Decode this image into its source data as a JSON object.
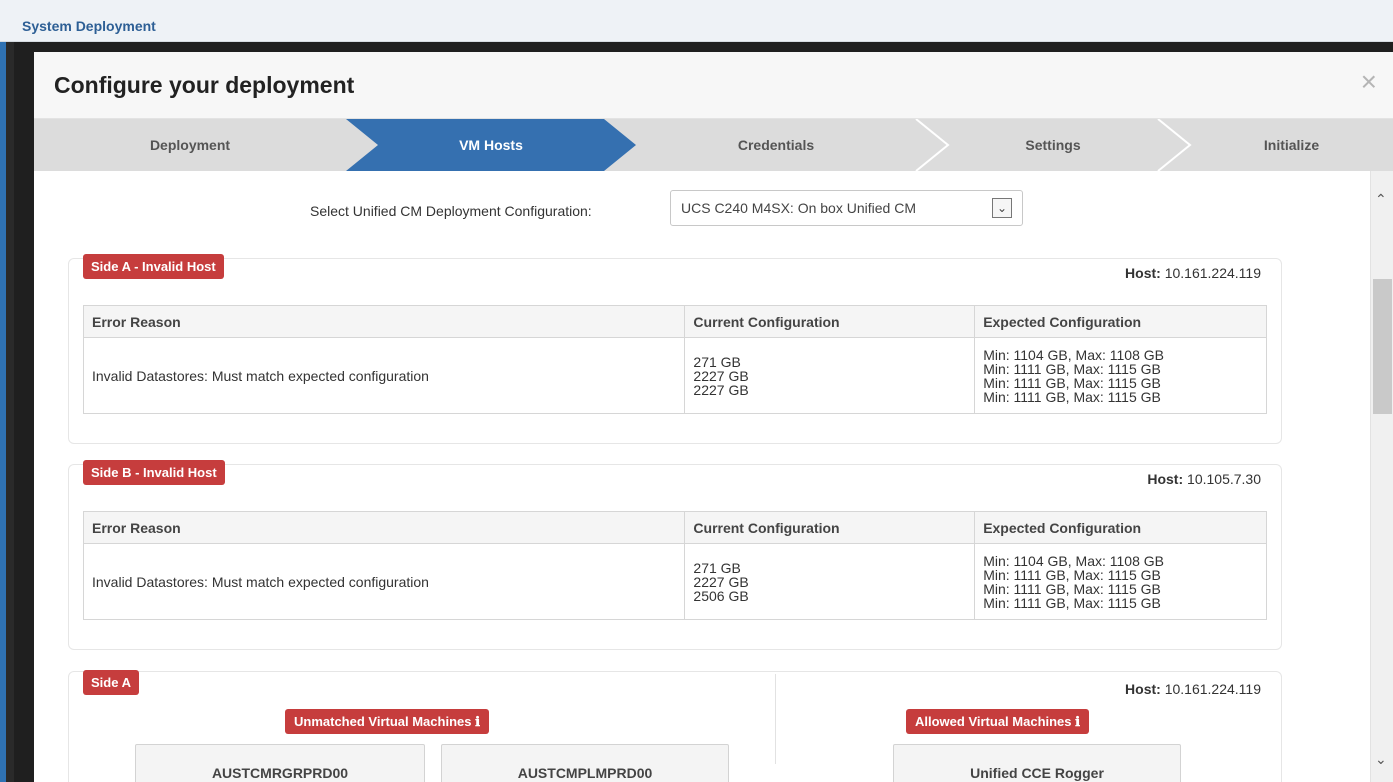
{
  "window": {
    "title": "System Deployment"
  },
  "modal": {
    "title": "Configure your deployment",
    "close_glyph": "×"
  },
  "wizard": {
    "steps": [
      {
        "label": "Deployment",
        "active": false
      },
      {
        "label": "VM Hosts",
        "active": true
      },
      {
        "label": "Credentials",
        "active": false
      },
      {
        "label": "Settings",
        "active": false
      },
      {
        "label": "Initialize",
        "active": false
      }
    ]
  },
  "config": {
    "label": "Select Unified CM Deployment Configuration:",
    "selected": "UCS C240 M4SX: On box Unified CM",
    "arrow": "⌄"
  },
  "table_headers": [
    "Error Reason",
    "Current Configuration",
    "Expected Configuration"
  ],
  "hosts": [
    {
      "badge": "Side A - Invalid Host",
      "host_label": "Host:",
      "host_ip": "10.161.224.119",
      "reason": "Invalid Datastores: Must match expected configuration",
      "current": [
        "271 GB",
        "2227 GB",
        "2227 GB"
      ],
      "expected": [
        "Min: 1104 GB, Max: 1108 GB",
        "Min: 1111 GB, Max: 1115 GB",
        "Min: 1111 GB, Max: 1115 GB",
        "Min: 1111 GB, Max: 1115 GB"
      ]
    },
    {
      "badge": "Side B - Invalid Host",
      "host_label": "Host:",
      "host_ip": "10.105.7.30",
      "reason": "Invalid Datastores: Must match expected configuration",
      "current": [
        "271 GB",
        "2227 GB",
        "2506 GB"
      ],
      "expected": [
        "Min: 1104 GB, Max: 1108 GB",
        "Min: 1111 GB, Max: 1115 GB",
        "Min: 1111 GB, Max: 1115 GB",
        "Min: 1111 GB, Max: 1115 GB"
      ]
    }
  ],
  "side_a": {
    "badge": "Side A",
    "host_label": "Host:",
    "host_ip": "10.161.224.119",
    "unmatched_label": "Unmatched Virtual Machines",
    "allowed_label": "Allowed Virtual Machines",
    "info_glyph": "ℹ",
    "unmatched_vms": [
      "AUSTCMRGRPRD00",
      "AUSTCMPLMPRD00"
    ],
    "allowed_vms": [
      "Unified CCE Rogger"
    ]
  },
  "colors": {
    "primary": "#2f72b3",
    "danger": "#c63d3d",
    "step_inactive": "#dcdcdc"
  }
}
